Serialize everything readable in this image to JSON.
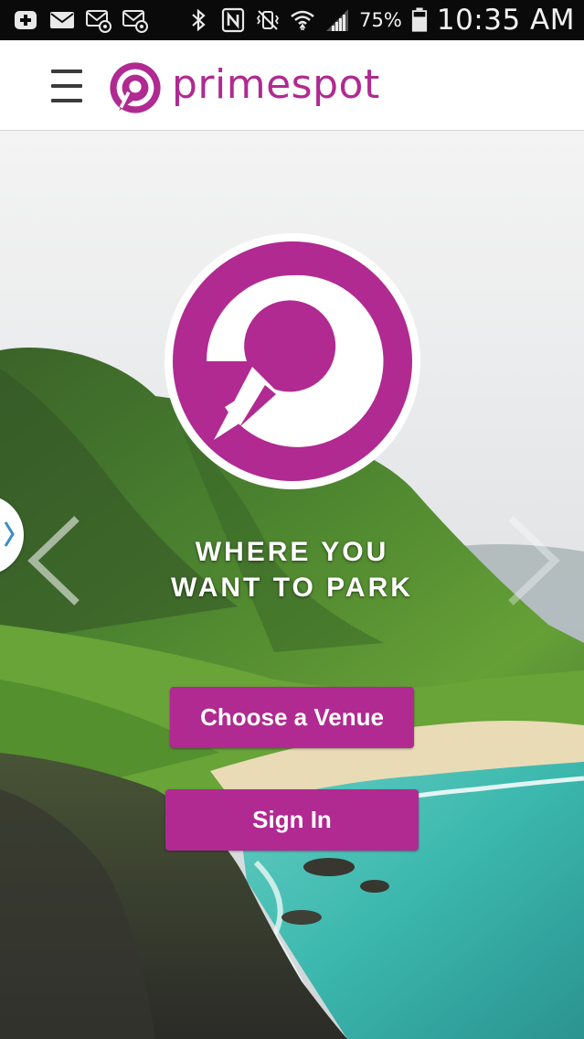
{
  "status_bar": {
    "icons_left": [
      "add-notification-icon",
      "mail-icon",
      "email-at-icon",
      "email-at-icon"
    ],
    "icons_right": [
      "bluetooth-icon",
      "nfc-icon",
      "vibrate-icon",
      "wifi-icon",
      "signal-icon",
      "battery-icon"
    ],
    "battery_percent": "75%",
    "time": "10:35 AM"
  },
  "header": {
    "brand_name": "primespot",
    "menu_icon": "hamburger-menu-icon"
  },
  "hero": {
    "tagline_line1": "WHERE YOU",
    "tagline_line2": "WANT TO PARK",
    "choose_venue_label": "Choose a Venue",
    "sign_in_label": "Sign In"
  },
  "colors": {
    "brand": "#b02a91",
    "header_bg": "#ffffff",
    "status_bar_bg": "#0a0a0a",
    "text_light": "#ffffff"
  }
}
